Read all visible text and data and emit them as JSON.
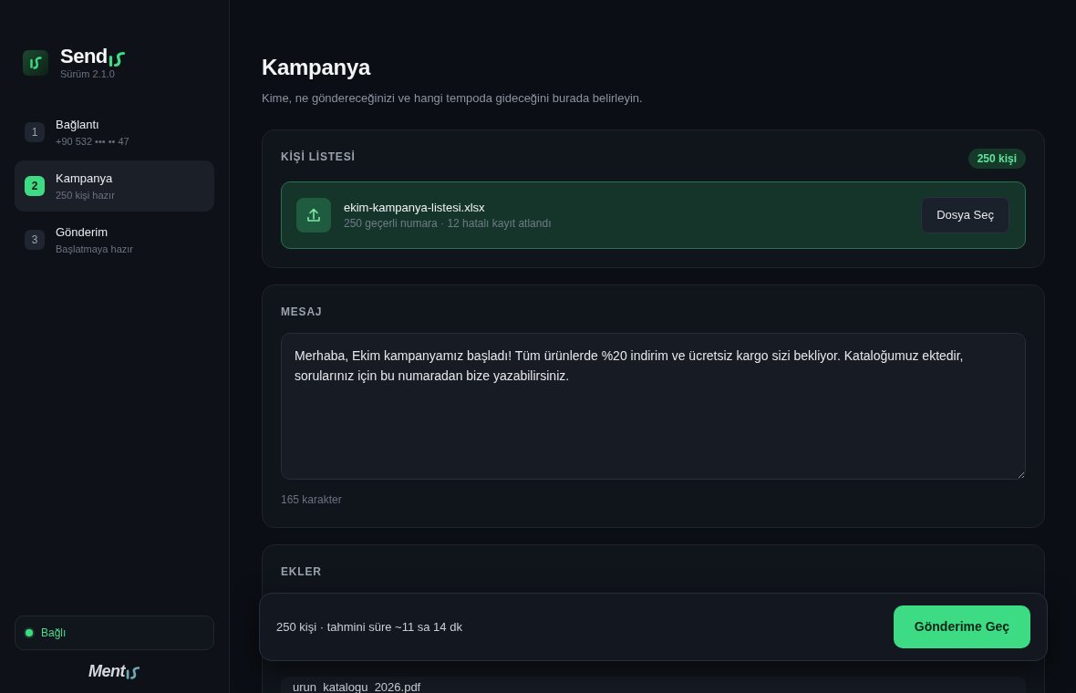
{
  "sidebar": {
    "brand": {
      "name": "Send",
      "version": "Sürüm 2.1.0"
    },
    "steps": [
      {
        "number": "1",
        "title": "Bağlantı",
        "subtitle": "+90 532 ••• •• 47",
        "selected": false
      },
      {
        "number": "2",
        "title": "Kampanya",
        "subtitle": "250 kişi hazır",
        "selected": true
      },
      {
        "number": "3",
        "title": "Gönderim",
        "subtitle": "Başlatmaya hazır",
        "selected": false
      }
    ],
    "status": {
      "label": "Bağlı",
      "connected": true
    },
    "footer_brand": "Ment"
  },
  "page": {
    "title": "Kampanya",
    "subtitle": "Kime, ne göndereceğinizi ve hangi tempoda gideceğini burada belirleyin."
  },
  "contact_list": {
    "heading": "KİŞİ LİSTESİ",
    "badge": "250 kişi",
    "file": {
      "name": "ekim-kampanya-listesi.xlsx",
      "details": "250 geçerli numara · 12 hatalı kayıt atlandı"
    },
    "button": "Dosya Seç"
  },
  "message": {
    "heading": "MESAJ",
    "value": "Merhaba, Ekim kampanyamız başladı! Tüm ürünlerde %20 indirim ve ücretsiz kargo sizi bekliyor. Kataloğumuz ektedir, sorularınız için bu numaradan bize yazabilirsiniz.",
    "char_count": "165 karakter"
  },
  "attachments": {
    "heading": "EKLER",
    "files": [
      {
        "name": "urun_katalogu_2026.pdf"
      }
    ]
  },
  "summary_bar": {
    "text": "250 kişi · tahmini süre ~11 sa 14 dk",
    "button": "Gönderime Geç"
  }
}
